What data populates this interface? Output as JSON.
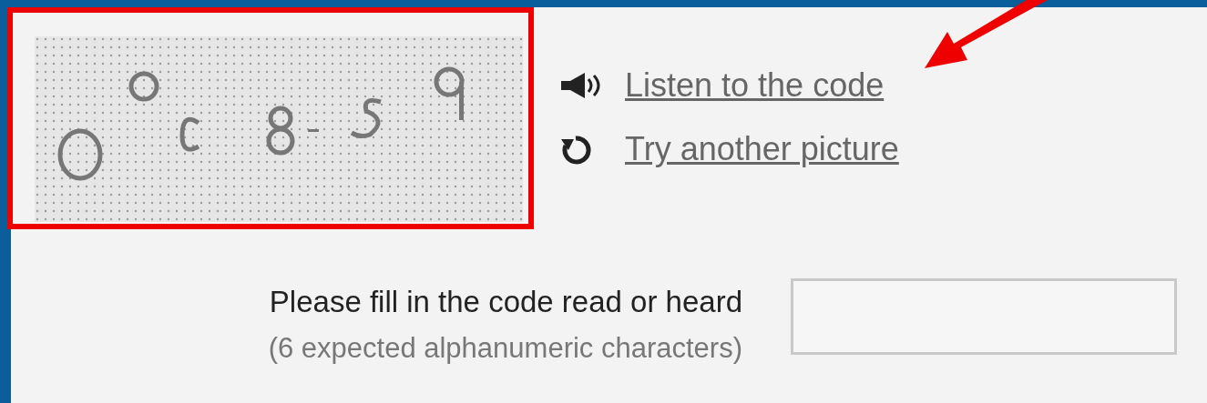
{
  "captcha": {
    "links": [
      {
        "kind": "audio",
        "label": "Listen to the code"
      },
      {
        "kind": "refresh",
        "label": "Try another picture"
      }
    ]
  },
  "answer": {
    "label": "Please fill in the code read or heard",
    "hint": "(6 expected alphanumeric characters)"
  }
}
